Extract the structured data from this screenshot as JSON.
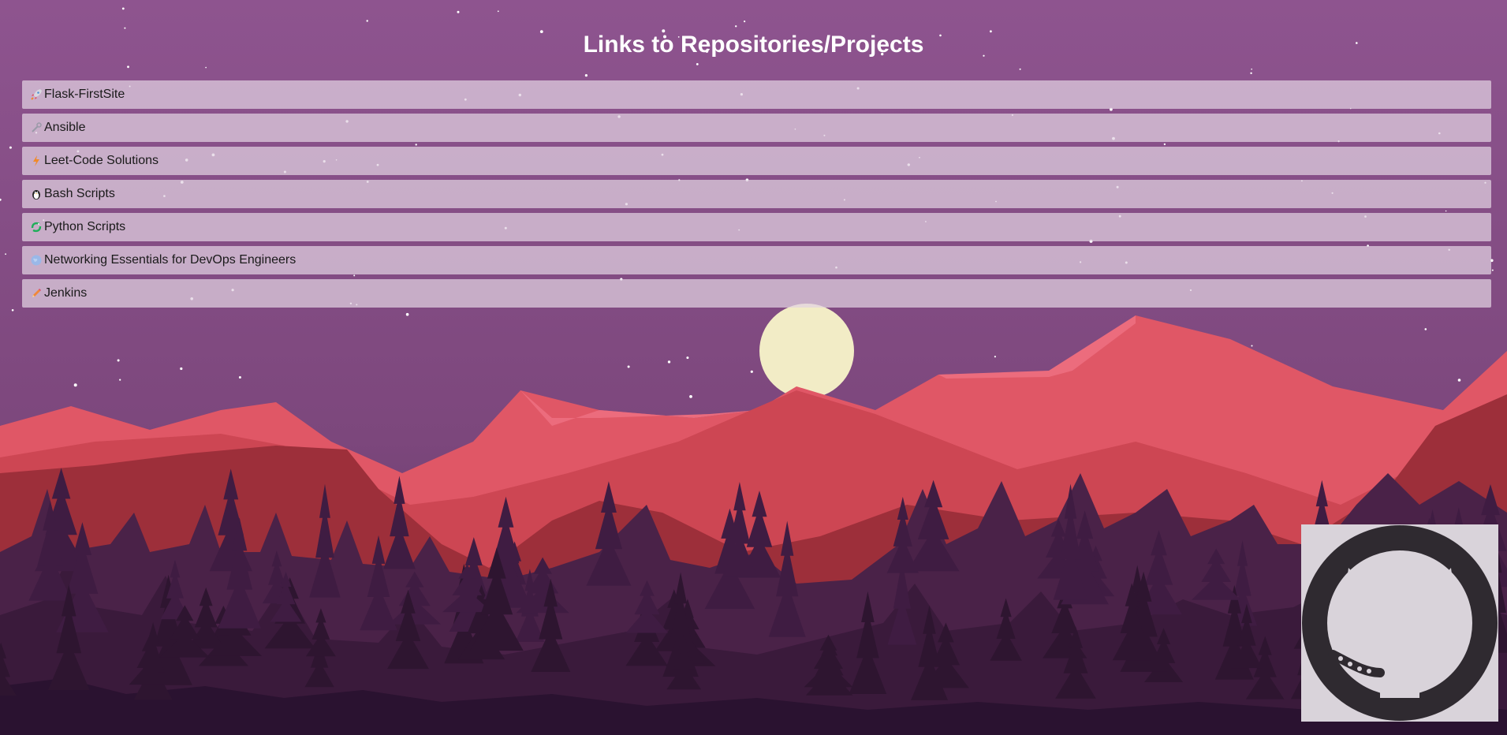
{
  "page": {
    "title": "Links to Repositories/Projects"
  },
  "repos": [
    {
      "label": "Flask-FirstSite",
      "icon": "rocket-icon"
    },
    {
      "label": "Ansible",
      "icon": "wrench-icon"
    },
    {
      "label": "Leet-Code Solutions",
      "icon": "lightning-icon"
    },
    {
      "label": "Bash Scripts",
      "icon": "penguin-icon"
    },
    {
      "label": "Python Scripts",
      "icon": "python-icon"
    },
    {
      "label": "Networking Essentials for DevOps Engineers",
      "icon": "globe-icon"
    },
    {
      "label": "Jenkins",
      "icon": "pencil-icon"
    }
  ],
  "github": {
    "icon": "github-octocat-icon"
  },
  "colors": {
    "sky_top": "#8e548f",
    "sky_bottom": "#6a3e6f",
    "moon": "#f2ecc6",
    "mountain_far": "#e05766",
    "mountain_mid": "#d04a57",
    "mountain_near": "#9d2f3a",
    "forest": "#4a2248",
    "forest_dark": "#2e1530"
  }
}
